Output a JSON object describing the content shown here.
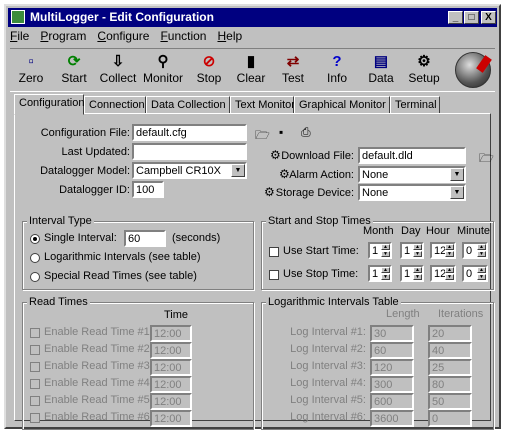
{
  "window": {
    "title": "MultiLogger - Edit Configuration",
    "min": "_",
    "max": "□",
    "close": "X"
  },
  "menu": [
    "File",
    "Program",
    "Configure",
    "Function",
    "Help"
  ],
  "toolbar": [
    {
      "label": "Zero",
      "icon": "zero-icon",
      "glyph": "▫",
      "color": "#000080"
    },
    {
      "label": "Start",
      "icon": "start-icon",
      "glyph": "⟳",
      "color": "#008000"
    },
    {
      "label": "Collect",
      "icon": "collect-icon",
      "glyph": "⇩",
      "color": "#000000"
    },
    {
      "label": "Monitor",
      "icon": "monitor-icon",
      "glyph": "⚲",
      "color": "#000000"
    },
    {
      "label": "Stop",
      "icon": "stop-icon",
      "glyph": "⊘",
      "color": "#cc0000"
    },
    {
      "label": "Clear",
      "icon": "clear-icon",
      "glyph": "▮",
      "color": "#000000"
    },
    {
      "label": "Test",
      "icon": "test-icon",
      "glyph": "⇄",
      "color": "#800000"
    },
    {
      "label": "Info",
      "icon": "info-icon",
      "glyph": "?",
      "color": "#0000cc"
    },
    {
      "label": "Data",
      "icon": "data-icon",
      "glyph": "▤",
      "color": "#000080"
    },
    {
      "label": "Setup",
      "icon": "setup-icon",
      "glyph": "⚙",
      "color": "#000000"
    }
  ],
  "tabs": [
    "Configuration",
    "Connection",
    "Data Collection",
    "Text Monitor",
    "Graphical Monitor",
    "Terminal"
  ],
  "config": {
    "config_file_label": "Configuration File:",
    "config_file": "default.cfg",
    "last_updated_label": "Last Updated:",
    "last_updated": "",
    "model_label": "Datalogger Model:",
    "model": "Campbell CR10X",
    "id_label": "Datalogger ID:",
    "id": "100",
    "download_label": "Download File:",
    "download": "default.dld",
    "alarm_label": "Alarm Action:",
    "alarm": "None",
    "storage_label": "Storage Device:",
    "storage": "None"
  },
  "interval": {
    "title": "Interval Type",
    "single_label": "Single Interval:",
    "single_value": "60",
    "seconds": "(seconds)",
    "log_label": "Logarithmic Intervals (see table)",
    "special_label": "Special Read Times (see table)"
  },
  "startstop": {
    "title": "Start and Stop Times",
    "headers": [
      "Month",
      "Day",
      "Hour",
      "Minute"
    ],
    "start_label": "Use Start Time:",
    "start": [
      "1",
      "1",
      "12",
      "0"
    ],
    "stop_label": "Use Stop Time:",
    "stop": [
      "1",
      "1",
      "12",
      "0"
    ]
  },
  "readtimes": {
    "title": "Read Times",
    "time_header": "Time",
    "rows": [
      {
        "label": "Enable Read Time #1:",
        "time": "12:00"
      },
      {
        "label": "Enable Read Time #2:",
        "time": "12:00"
      },
      {
        "label": "Enable Read Time #3:",
        "time": "12:00"
      },
      {
        "label": "Enable Read Time #4:",
        "time": "12:00"
      },
      {
        "label": "Enable Read Time #5:",
        "time": "12:00"
      },
      {
        "label": "Enable Read Time #6:",
        "time": "12:00"
      }
    ]
  },
  "logtable": {
    "title": "Logarithmic Intervals Table",
    "length_header": "Length",
    "iter_header": "Iterations",
    "rows": [
      {
        "label": "Log Interval #1:",
        "length": "30",
        "iter": "20"
      },
      {
        "label": "Log Interval #2:",
        "length": "60",
        "iter": "40"
      },
      {
        "label": "Log Interval #3:",
        "length": "120",
        "iter": "25"
      },
      {
        "label": "Log Interval #4:",
        "length": "300",
        "iter": "80"
      },
      {
        "label": "Log Interval #5:",
        "length": "600",
        "iter": "50"
      },
      {
        "label": "Log Interval #6:",
        "length": "3600",
        "iter": "0"
      }
    ]
  },
  "colors": {
    "titlebar": "#000080",
    "face": "#c0c0c0"
  }
}
